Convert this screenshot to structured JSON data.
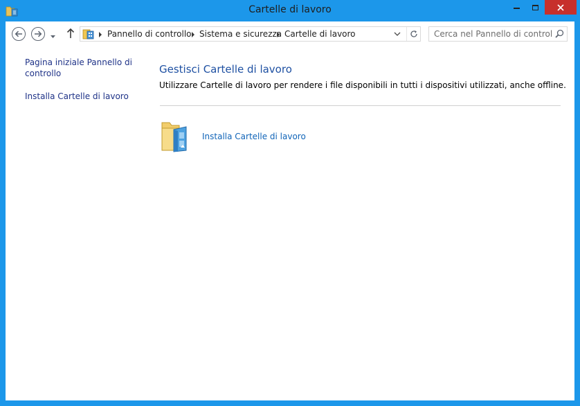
{
  "window": {
    "title": "Cartelle di lavoro",
    "icon": "work-folders-icon",
    "controls": {
      "minimize": "minimize-icon",
      "maximize": "maximize-icon",
      "close": "close-icon"
    },
    "accent_color": "#1c97ea",
    "close_color": "#c7302b"
  },
  "navigation": {
    "back": "back-arrow-icon",
    "forward": "forward-arrow-icon",
    "recent": "recent-locations-icon",
    "up": "up-arrow-icon"
  },
  "address_bar": {
    "breadcrumbs": [
      "Pannello di controllo",
      "Sistema e sicurezza",
      "Cartelle di lavoro"
    ],
    "icon": "control-panel-icon",
    "dropdown": "chevron-down-icon",
    "refresh": "refresh-icon"
  },
  "search": {
    "placeholder": "Cerca nel Pannello di controllo",
    "value": ""
  },
  "left_pane": {
    "links": [
      {
        "label": "Pagina iniziale Pannello di controllo"
      },
      {
        "label": "Installa Cartelle di lavoro"
      }
    ]
  },
  "main": {
    "heading": "Gestisci Cartelle di lavoro",
    "description": "Utilizzare Cartelle di lavoro per rendere i file disponibili in tutti i dispositivi utilizzati, anche offline.",
    "task": {
      "label": "Installa Cartelle di lavoro",
      "icon": "work-folders-icon"
    },
    "link_color": "#1064b8",
    "heading_color": "#1e50a2"
  }
}
